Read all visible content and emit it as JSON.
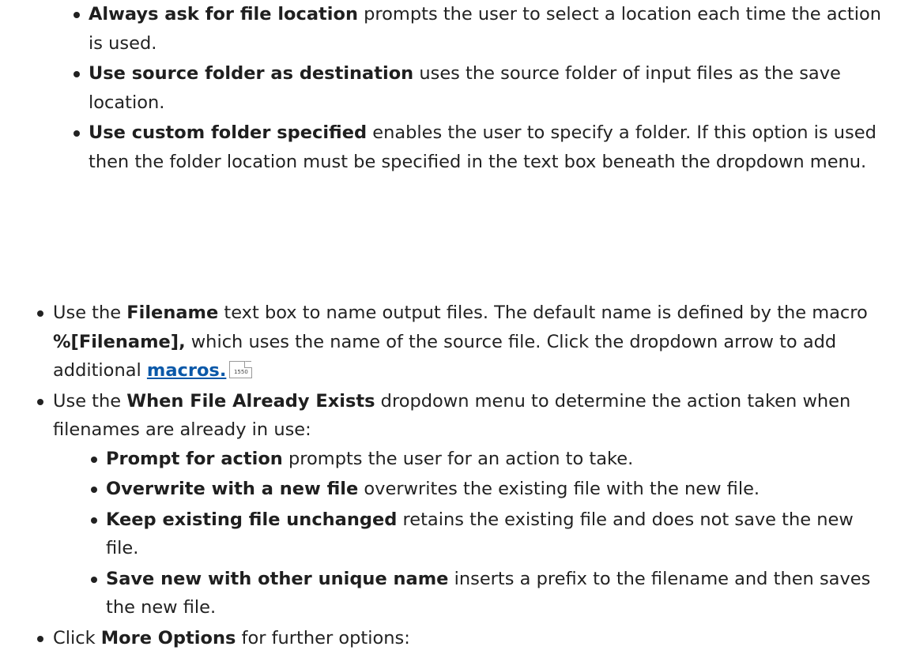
{
  "save_location_options": [
    {
      "term": "Always ask for file location",
      "desc": " prompts the user to select a location each time the action is used."
    },
    {
      "term": "Use source folder as destination",
      "desc": " uses the source folder of input files as the save location."
    },
    {
      "term": "Use custom folder specified",
      "desc": " enables the user to specify a folder. If this option is used then the folder location must be specified in the text box beneath the dropdown menu."
    }
  ],
  "filename_item": {
    "pre": "Use the ",
    "term": "Filename",
    "mid1": " text box to name output files. The default name is defined by the macro ",
    "macro": "%[Filename],",
    "mid2": " which uses the name of the source file. Click the dropdown arrow to add additional ",
    "link": "macros.",
    "page_ref": "1550"
  },
  "exists_item": {
    "pre": "Use the ",
    "term": "When File Already Exists",
    "post": " dropdown menu to determine the action taken when filenames are already in use:"
  },
  "exists_options": [
    {
      "term": "Prompt for action",
      "desc": " prompts the user for an action to take."
    },
    {
      "term": "Overwrite with a new file",
      "desc": " overwrites the existing file with the new file."
    },
    {
      "term": "Keep existing file unchanged",
      "desc": " retains the existing file and does not save the new file."
    },
    {
      "term": "Save new with other unique name",
      "desc": " inserts a prefix to the filename and then saves the new file."
    }
  ],
  "more_item": {
    "pre": "Click ",
    "term": "More Options",
    "post": " for further options:"
  }
}
